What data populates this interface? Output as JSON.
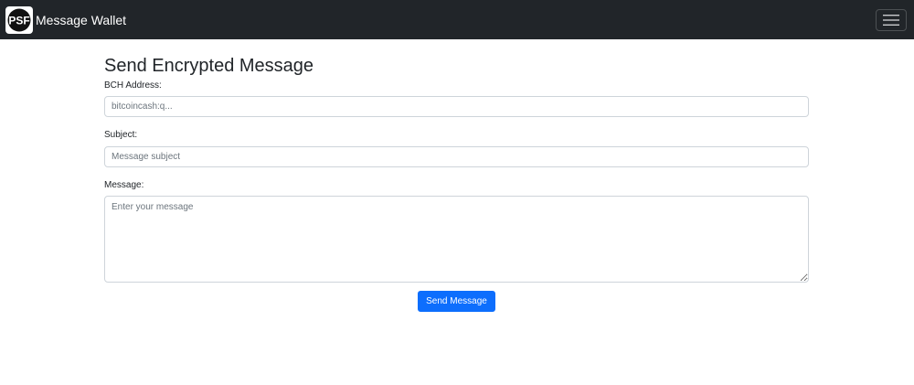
{
  "navbar": {
    "brand": "Message Wallet",
    "logo_text": "PSF",
    "logo_icon": "psf-logo-icon",
    "toggle_icon": "hamburger-menu-icon"
  },
  "form": {
    "title": "Send Encrypted Message",
    "bch_address": {
      "label": "BCH Address:",
      "placeholder": "bitcoincash:q...",
      "value": ""
    },
    "subject": {
      "label": "Subject:",
      "placeholder": "Message subject",
      "value": ""
    },
    "message": {
      "label": "Message:",
      "placeholder": "Enter your message",
      "value": ""
    },
    "submit_label": "Send Message"
  },
  "colors": {
    "navbar_bg": "#212529",
    "primary": "#0d6efd",
    "input_border": "#ced4da"
  }
}
